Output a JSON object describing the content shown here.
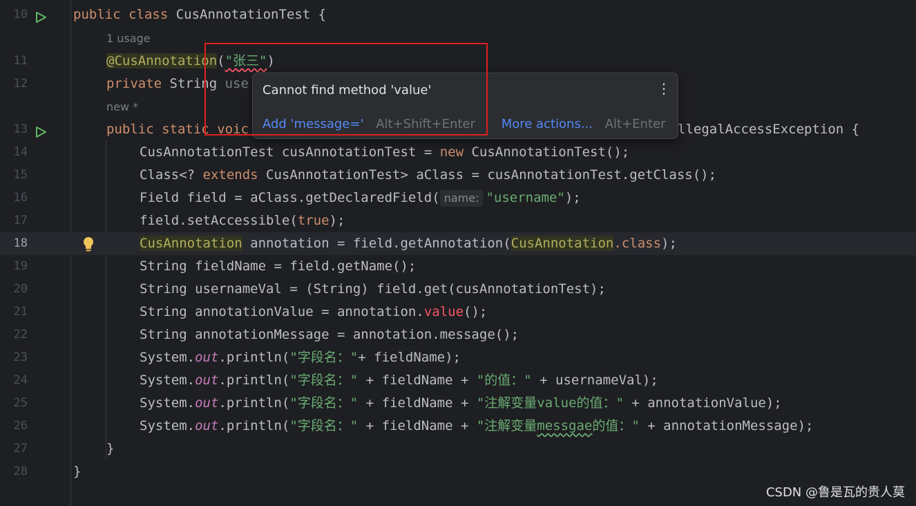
{
  "editor": {
    "hint_usage": "1 usage",
    "hint_new": "new *",
    "line_numbers": {
      "l10": "10",
      "l11": "11",
      "l12": "12",
      "l13": "13",
      "l14": "14",
      "l15": "15",
      "l16": "16",
      "l17": "17",
      "l18": "18",
      "l19": "19",
      "l20": "20",
      "l21": "21",
      "l22": "22",
      "l23": "23",
      "l24": "24",
      "l25": "25",
      "l26": "26",
      "l27": "27",
      "l28": "28"
    },
    "code": {
      "l10_kw1": "public",
      "l10_kw2": "class",
      "l10_rest": " CusAnnotationTest {",
      "l11_at": "@CusAnnotation",
      "l11_open": "(",
      "l11_str": "\"张三\"",
      "l11_close": ")",
      "l12_kw": "private",
      "l12_rest": " String ",
      "l12_partial": "use",
      "l13_kw1": "public",
      "l13_kw2": "static",
      "l13_partial": "voic",
      "l13_tail": "llegalAccessException {",
      "l14_a": "CusAnnotationTest cusAnnotationTest = ",
      "l14_kw": "new",
      "l14_b": " CusAnnotationTest();",
      "l15_a": "Class<? ",
      "l15_kw": "extends",
      "l15_b": " CusAnnotationTest> aClass = cusAnnotationTest.getClass();",
      "l16_a": "Field field = aClass.getDeclaredField(",
      "l16_hint": "name:",
      "l16_str": "\"username\"",
      "l16_b": ");",
      "l17_a": "field.setAccessible(",
      "l17_kw": "true",
      "l17_b": ");",
      "l18_type": "CusAnnotation",
      "l18_a": " annotation = field.getAnnotation(",
      "l18_type2": "CusAnnotation",
      "l18_kw": ".class",
      "l18_b": ");",
      "l19": "String fieldName = field.getName();",
      "l20": "String usernameVal = (String) field.get(cusAnnotationTest);",
      "l21_a": "String annotationValue = annotation.",
      "l21_err": "value",
      "l21_b": "();",
      "l22": "String annotationMessage = annotation.message();",
      "l23_a": "System.",
      "l23_out": "out",
      "l23_b": ".println(",
      "l23_str": "\"字段名：\"",
      "l23_c": "+ fieldName);",
      "l24_a": "System.",
      "l24_out": "out",
      "l24_b": ".println(",
      "l24_str1": "\"字段名：\"",
      "l24_c": " + fieldName + ",
      "l24_str2": "\"的值：\"",
      "l24_d": " + usernameVal);",
      "l25_a": "System.",
      "l25_out": "out",
      "l25_b": ".println(",
      "l25_str1": "\"字段名：\"",
      "l25_c": " + fieldName + ",
      "l25_str2": "\"注解变量value的值：\"",
      "l25_d": " + annotationValue);",
      "l26_a": "System.",
      "l26_out": "out",
      "l26_b": ".println(",
      "l26_str1": "\"字段名：\"",
      "l26_c": " + fieldName + ",
      "l26_str2a": "\"注解变量",
      "l26_str2b": "messgae",
      "l26_str2c": "的值：\"",
      "l26_d": " + annotationMessage);",
      "l27": "}",
      "l28": "}"
    }
  },
  "popup": {
    "message": "Cannot find method 'value'",
    "more_icon": "⋮",
    "action1_label": "Add 'message='",
    "action1_shortcut": "Alt+Shift+Enter",
    "action2_label": "More actions...",
    "action2_shortcut": "Alt+Enter"
  },
  "watermark": "CSDN @鲁是瓦的贵人莫",
  "colors": {
    "background": "#1e1f22",
    "keyword": "#cf8e6d",
    "string": "#6aab73",
    "annotation": "#b3ae60",
    "error": "#f75464",
    "link": "#548af7",
    "highlight_box": "#e02020"
  },
  "icons": {
    "run": "run-gutter-icon",
    "intention": "lightbulb-icon"
  }
}
